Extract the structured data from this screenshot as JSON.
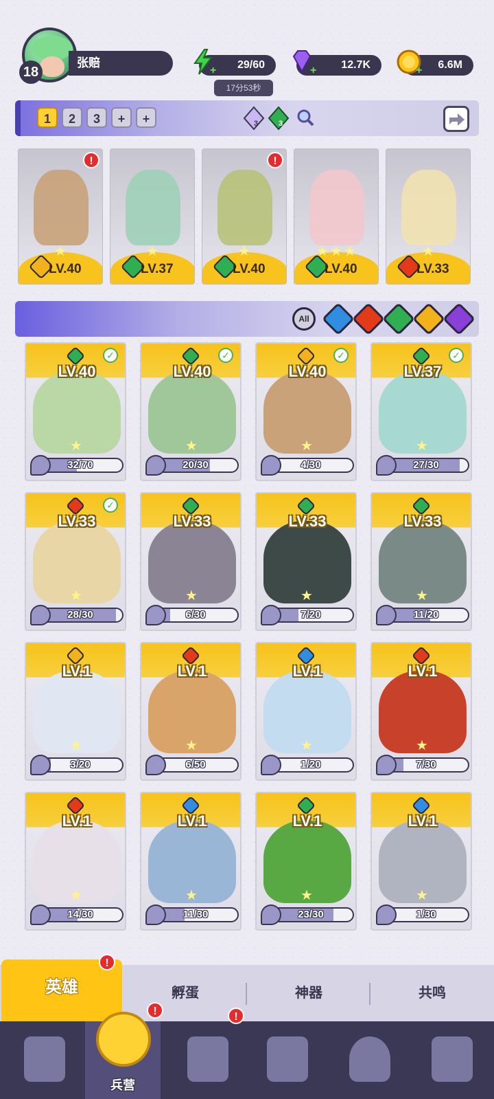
{
  "player": {
    "level": "18",
    "name": "张赔"
  },
  "resources": {
    "energy": "29/60",
    "energy_timer": "17分53秒",
    "gems": "12.7K",
    "gold": "6.6M"
  },
  "team_bar": {
    "tabs": [
      "1",
      "2",
      "3",
      "+",
      "+"
    ],
    "active_tab": "1",
    "counter_a": "3",
    "counter_b": "3"
  },
  "team": [
    {
      "level": "LV.40",
      "element": "light",
      "alert": true,
      "stars": 1
    },
    {
      "level": "LV.37",
      "element": "nature",
      "alert": false,
      "stars": 1
    },
    {
      "level": "LV.40",
      "element": "nature",
      "alert": true,
      "stars": 1
    },
    {
      "level": "LV.40",
      "element": "nature",
      "alert": false,
      "stars": 3
    },
    {
      "level": "LV.33",
      "element": "fire",
      "alert": false,
      "stars": 1
    }
  ],
  "filters": {
    "all_label": "All",
    "elements": [
      "water",
      "fire",
      "nature",
      "light",
      "dark"
    ]
  },
  "heroes": [
    {
      "level": "LV.40",
      "element": "nature",
      "shards": "32/70",
      "ratio": 0.46,
      "owned": true
    },
    {
      "level": "LV.40",
      "element": "nature",
      "shards": "20/30",
      "ratio": 0.67,
      "owned": true
    },
    {
      "level": "LV.40",
      "element": "light",
      "shards": "4/30",
      "ratio": 0.13,
      "owned": true
    },
    {
      "level": "LV.37",
      "element": "nature",
      "shards": "27/30",
      "ratio": 0.9,
      "owned": true
    },
    {
      "level": "LV.33",
      "element": "fire",
      "shards": "28/30",
      "ratio": 0.93,
      "owned": true
    },
    {
      "level": "LV.33",
      "element": "nature",
      "shards": "6/30",
      "ratio": 0.2,
      "owned": false
    },
    {
      "level": "LV.33",
      "element": "nature",
      "shards": "7/20",
      "ratio": 0.35,
      "owned": false
    },
    {
      "level": "LV.33",
      "element": "nature",
      "shards": "11/20",
      "ratio": 0.55,
      "owned": false
    },
    {
      "level": "LV.1",
      "element": "light",
      "shards": "3/20",
      "ratio": 0.15,
      "owned": false
    },
    {
      "level": "LV.1",
      "element": "fire",
      "shards": "6/50",
      "ratio": 0.12,
      "owned": false
    },
    {
      "level": "LV.1",
      "element": "water",
      "shards": "1/20",
      "ratio": 0.05,
      "owned": false
    },
    {
      "level": "LV.1",
      "element": "fire",
      "shards": "7/30",
      "ratio": 0.23,
      "owned": false
    },
    {
      "level": "LV.1",
      "element": "fire",
      "shards": "14/30",
      "ratio": 0.47,
      "owned": false
    },
    {
      "level": "LV.1",
      "element": "water",
      "shards": "11/30",
      "ratio": 0.37,
      "owned": false
    },
    {
      "level": "LV.1",
      "element": "nature",
      "shards": "23/30",
      "ratio": 0.77,
      "owned": false
    },
    {
      "level": "LV.1",
      "element": "water",
      "shards": "1/30",
      "ratio": 0.03,
      "owned": false
    }
  ],
  "sub_tabs": [
    {
      "label": "英雄",
      "active": true,
      "alert": true
    },
    {
      "label": "孵蛋",
      "active": false,
      "alert": false
    },
    {
      "label": "神器",
      "active": false,
      "alert": false
    },
    {
      "label": "共鸣",
      "active": false,
      "alert": false
    }
  ],
  "nav": [
    {
      "label": "",
      "icon": "cards-icon",
      "active": false,
      "alert": false
    },
    {
      "label": "兵营",
      "icon": "barracks-icon",
      "active": true,
      "alert": true
    },
    {
      "label": "",
      "icon": "map-icon",
      "active": false,
      "alert": true
    },
    {
      "label": "",
      "icon": "castle-icon",
      "active": false,
      "alert": false
    },
    {
      "label": "",
      "icon": "mushroom-icon",
      "active": false,
      "alert": false
    },
    {
      "label": "",
      "icon": "banner-icon",
      "active": false,
      "alert": false
    }
  ],
  "element_colors": {
    "light": "#f2b21c",
    "nature": "#2fae52",
    "fire": "#e33a1a",
    "water": "#2f8ee0",
    "dark": "#8a3fd8"
  }
}
